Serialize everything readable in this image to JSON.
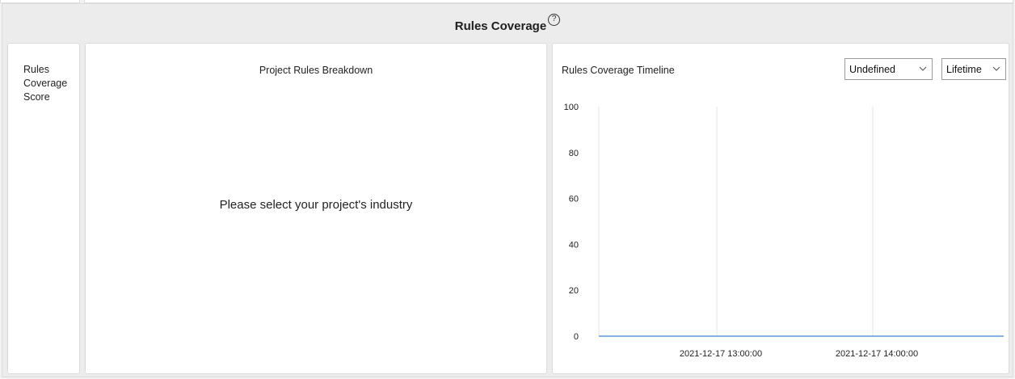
{
  "section": {
    "title": "Rules Coverage",
    "help_icon": "question-circle-icon"
  },
  "score_card": {
    "label_line1": "Rules",
    "label_line2": "Coverage",
    "label_line3": "Score"
  },
  "breakdown": {
    "title": "Project Rules Breakdown",
    "empty_message": "Please select your project's industry"
  },
  "timeline": {
    "title": "Rules Coverage Timeline",
    "industry_select": {
      "value": "Undefined",
      "icon": "chevron-down-icon"
    },
    "range_select": {
      "value": "Lifetime",
      "icon": "chevron-down-icon"
    }
  },
  "chart_data": {
    "type": "line",
    "title": "Rules Coverage Timeline",
    "xlabel": "",
    "ylabel": "",
    "ylim": [
      0,
      100
    ],
    "yticks": [
      0,
      20,
      40,
      60,
      80,
      100
    ],
    "xticks": [
      "2021-12-17 13:00:00",
      "2021-12-17 14:00:00"
    ],
    "grid": "vertical",
    "colors": {
      "line": "#5b9bd5",
      "grid": "#e6e6e6"
    },
    "series": [
      {
        "values": [
          0,
          0,
          0,
          0
        ]
      }
    ]
  }
}
